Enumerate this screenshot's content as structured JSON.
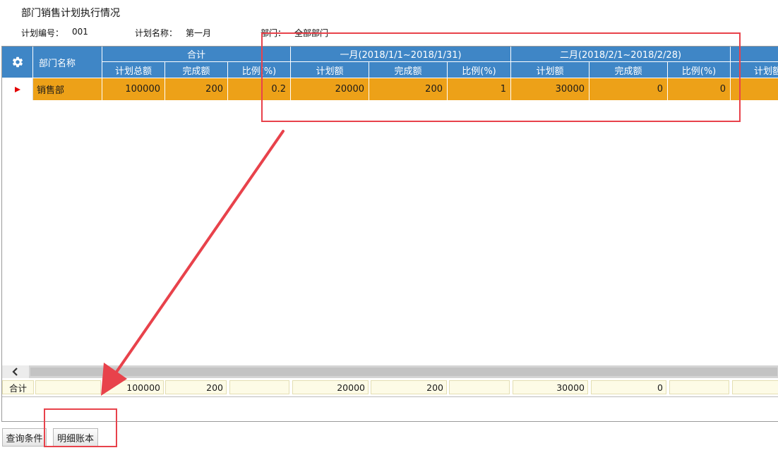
{
  "page": {
    "title": "部门销售计划执行情况"
  },
  "info": {
    "plan_no_label": "计划编号：",
    "plan_no_value": "001",
    "plan_name_label": "计划名称：",
    "plan_name_value": "第一月",
    "dept_label": "部门：",
    "dept_value": "全部部门"
  },
  "grid": {
    "settings_icon": "gear-icon",
    "dept_header": "部门名称",
    "groups": [
      {
        "label": "合计",
        "cols": [
          "计划总额",
          "完成额",
          "比例(%)"
        ]
      },
      {
        "label": "一月(2018/1/1~2018/1/31)",
        "cols": [
          "计划额",
          "完成额",
          "比例(%)"
        ]
      },
      {
        "label": "二月(2018/2/1~2018/2/28)",
        "cols": [
          "计划额",
          "完成额",
          "比例(%)"
        ]
      },
      {
        "label": "",
        "cols": [
          "计划额"
        ]
      }
    ],
    "rows": [
      {
        "dept": "销售部",
        "values": [
          "100000",
          "200",
          "0.2",
          "20000",
          "200",
          "1",
          "30000",
          "0",
          "0",
          ""
        ]
      }
    ],
    "footer": {
      "label": "合计",
      "values": [
        "",
        "100000",
        "200",
        "",
        "20000",
        "200",
        "",
        "30000",
        "0",
        "",
        ""
      ]
    },
    "scroll_left_icon": "chevron-left-icon"
  },
  "buttons": {
    "query": "查询条件",
    "detail": "明细账本"
  },
  "annotation": {
    "color": "#e8424b"
  }
}
